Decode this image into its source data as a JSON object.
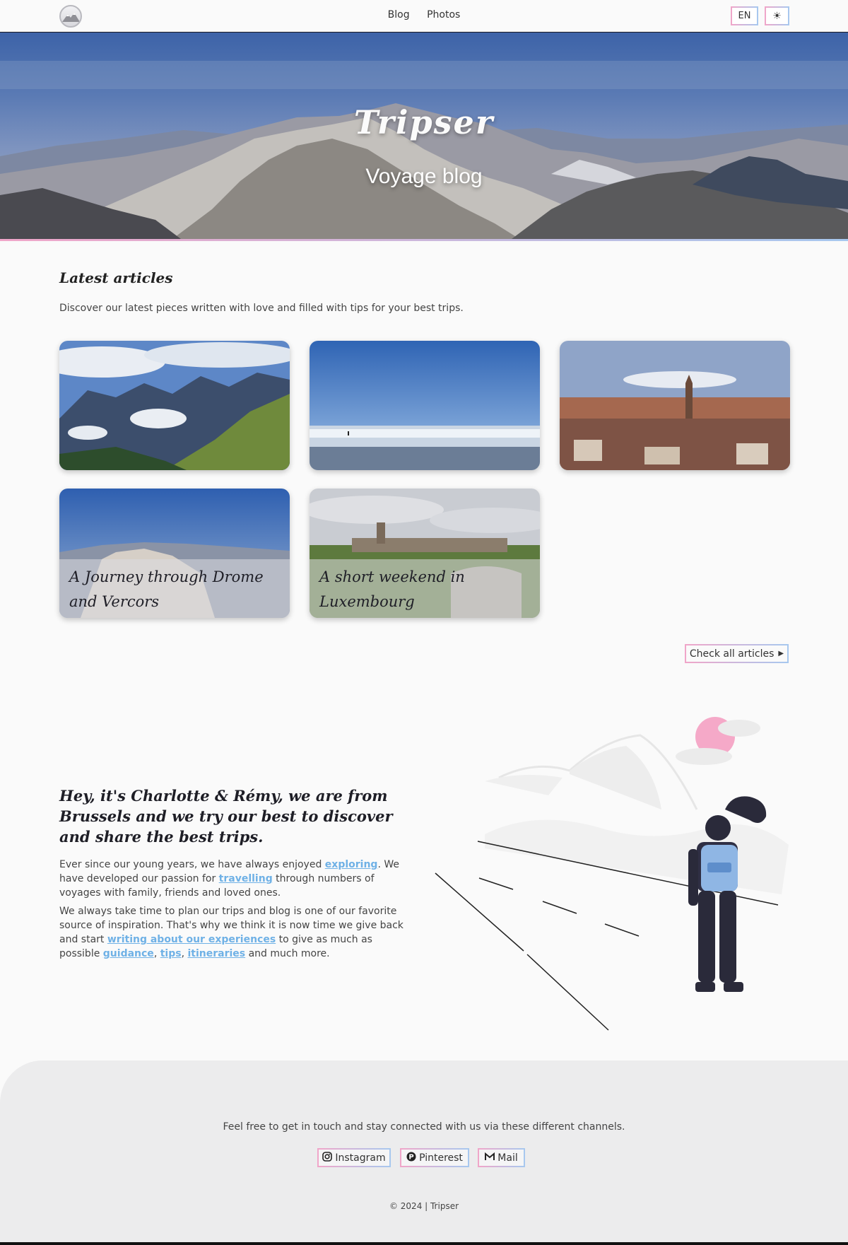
{
  "header": {
    "logo_icon": "mountain-logo-icon",
    "nav": [
      {
        "label": "Blog"
      },
      {
        "label": "Photos"
      }
    ],
    "lang_label": "EN",
    "theme_icon": "sun-icon"
  },
  "hero": {
    "title": "Tripser",
    "subtitle": "Voyage blog"
  },
  "latest": {
    "title": "Latest articles",
    "description": "Discover our latest pieces written with love and filled with tips for your best trips.",
    "cards": [
      {
        "caption": ""
      },
      {
        "caption": ""
      },
      {
        "caption": ""
      },
      {
        "caption": "A Journey through Drome and Vercors"
      },
      {
        "caption": "A short weekend in Luxembourg"
      }
    ],
    "check_all_label": "Check all articles",
    "check_all_icon": "caret-right-icon"
  },
  "about": {
    "title": "Hey, it's Charlotte & Rémy, we are from Brussels and we try our best to discover and share the best trips.",
    "p1": {
      "a": "Ever since our young years, we have always enjoyed ",
      "link1": "exploring",
      "b": ". We have developed our passion for ",
      "link2": "travelling",
      "c": " through numbers of voyages with family, friends and loved ones."
    },
    "p2": {
      "a": "We always take time to plan our trips and blog is one of our favorite source of inspiration. That's why we think it is now time we give back and start ",
      "link1": "writing about our experiences",
      "b": " to give as much as possible ",
      "link2": "guidance",
      "c": ", ",
      "link3": "tips",
      "d": ", ",
      "link4": "itineraries",
      "e": " and much more."
    },
    "illustration": "traveler-illustration"
  },
  "footer": {
    "text": "Feel free to get in touch and stay connected with us via these different channels.",
    "links": [
      {
        "label": "Instagram",
        "icon": "instagram-icon"
      },
      {
        "label": "Pinterest",
        "icon": "pinterest-icon"
      },
      {
        "label": "Mail",
        "icon": "gmail-icon"
      }
    ],
    "copyright": "© 2024 | Tripser"
  },
  "colors": {
    "accent_pink": "#f0a6c9",
    "accent_blue": "#a7c8ef",
    "link": "#6fb1e6",
    "footer_bg": "#ececed"
  }
}
